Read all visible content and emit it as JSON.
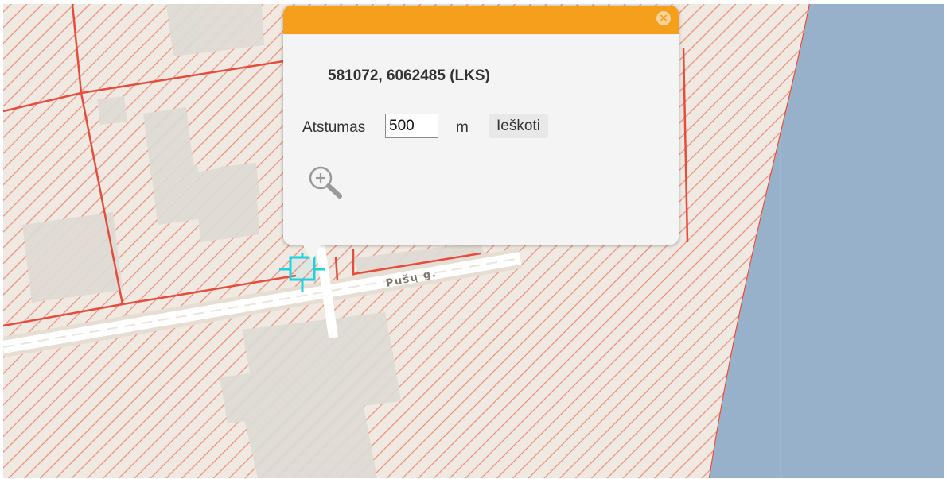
{
  "map": {
    "street_name": "Pušų g.",
    "colors": {
      "land": "#efe9e2",
      "water": "#98b1cb",
      "building": "#dedad4",
      "parcel_hatch": "#ec8b79",
      "parcel_border": "#e64c3c",
      "street": "#ffffff",
      "marker": "#1fd2e0"
    },
    "marker_icon": "crosshair-marker-icon"
  },
  "popup": {
    "coordinates": "581072, 6062485 (LKS)",
    "distance_label": "Atstumas",
    "distance_value": "500",
    "distance_unit": "m",
    "search_button": "Ieškoti",
    "close_icon": "close-circle-icon",
    "zoom_icon": "zoom-in-icon",
    "header_color": "#f59f1c"
  }
}
